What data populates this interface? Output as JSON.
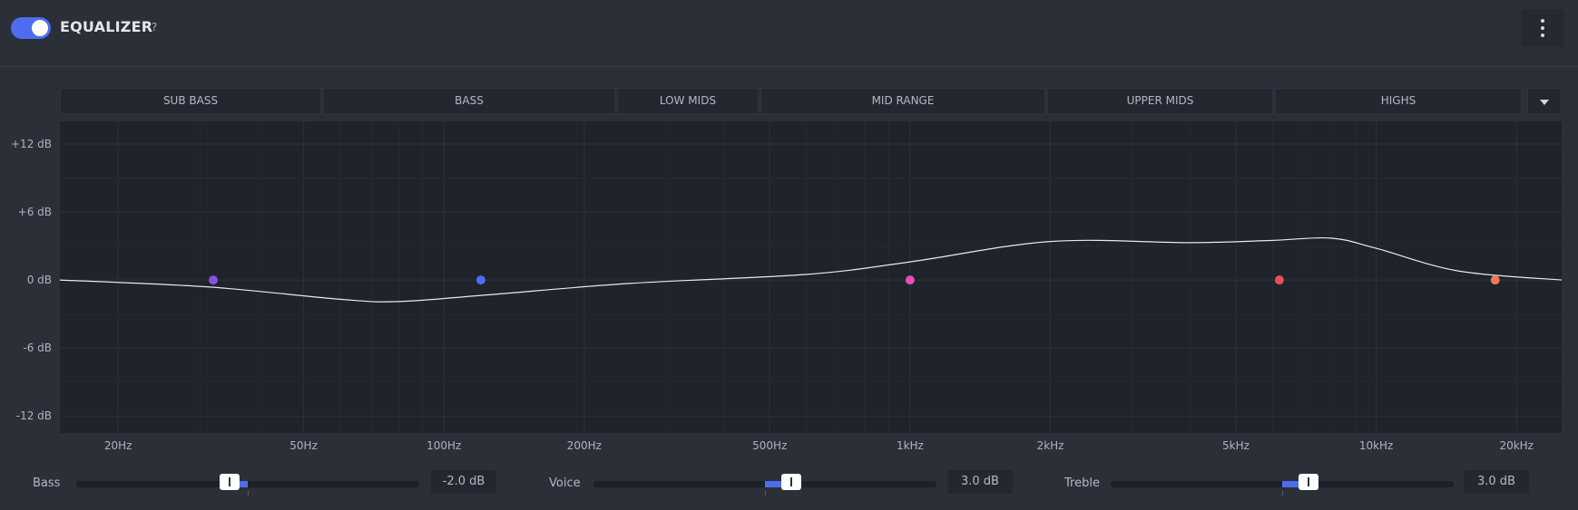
{
  "header": {
    "title": "EQUALIZER",
    "help": "?",
    "toggle_on": true
  },
  "bands": [
    {
      "label": "SUB BASS"
    },
    {
      "label": "BASS"
    },
    {
      "label": "LOW MIDS"
    },
    {
      "label": "MID RANGE"
    },
    {
      "label": "UPPER MIDS"
    },
    {
      "label": "HIGHS"
    }
  ],
  "chart_data": {
    "type": "line",
    "x_scale": "log",
    "xlim_hz": [
      15,
      25000
    ],
    "ylim_db": [
      -13.5,
      14
    ],
    "y_ticks": [
      {
        "value": 12,
        "label": "+12 dB"
      },
      {
        "value": 6,
        "label": "+6 dB"
      },
      {
        "value": 0,
        "label": "0 dB"
      },
      {
        "value": -6,
        "label": "-6 dB"
      },
      {
        "value": -12,
        "label": "-12 dB"
      }
    ],
    "x_ticks": [
      {
        "value": 20,
        "label": "20Hz"
      },
      {
        "value": 50,
        "label": "50Hz"
      },
      {
        "value": 100,
        "label": "100Hz"
      },
      {
        "value": 200,
        "label": "200Hz"
      },
      {
        "value": 500,
        "label": "500Hz"
      },
      {
        "value": 1000,
        "label": "1kHz"
      },
      {
        "value": 2000,
        "label": "2kHz"
      },
      {
        "value": 5000,
        "label": "5kHz"
      },
      {
        "value": 10000,
        "label": "10kHz"
      },
      {
        "value": 20000,
        "label": "20kHz"
      }
    ],
    "curve": [
      [
        15,
        0
      ],
      [
        31,
        -0.6
      ],
      [
        60,
        -1.7
      ],
      [
        80,
        -1.9
      ],
      [
        125,
        -1.3
      ],
      [
        250,
        -0.3
      ],
      [
        600,
        0.5
      ],
      [
        1000,
        1.6
      ],
      [
        2000,
        3.4
      ],
      [
        4000,
        3.3
      ],
      [
        6000,
        3.5
      ],
      [
        8000,
        3.7
      ],
      [
        10000,
        2.8
      ],
      [
        15000,
        0.8
      ],
      [
        25000,
        0
      ]
    ],
    "points": [
      {
        "freq": 32,
        "gain": 0,
        "color": "#8a4fe0"
      },
      {
        "freq": 120,
        "gain": 0,
        "color": "#4f6cf0"
      },
      {
        "freq": 1000,
        "gain": 0,
        "color": "#e84fb0"
      },
      {
        "freq": 6200,
        "gain": 0,
        "color": "#e84f5a"
      },
      {
        "freq": 18000,
        "gain": 0,
        "color": "#f07a4f"
      }
    ]
  },
  "controls": [
    {
      "label": "Bass",
      "value": -2.0,
      "display": "-2.0 dB"
    },
    {
      "label": "Voice",
      "value": 3.0,
      "display": "3.0 dB"
    },
    {
      "label": "Treble",
      "value": 3.0,
      "display": "3.0 dB"
    }
  ],
  "colors": {
    "accent": "#4f6cf0",
    "background": "#2a2f38",
    "plot": "#1f232a"
  }
}
